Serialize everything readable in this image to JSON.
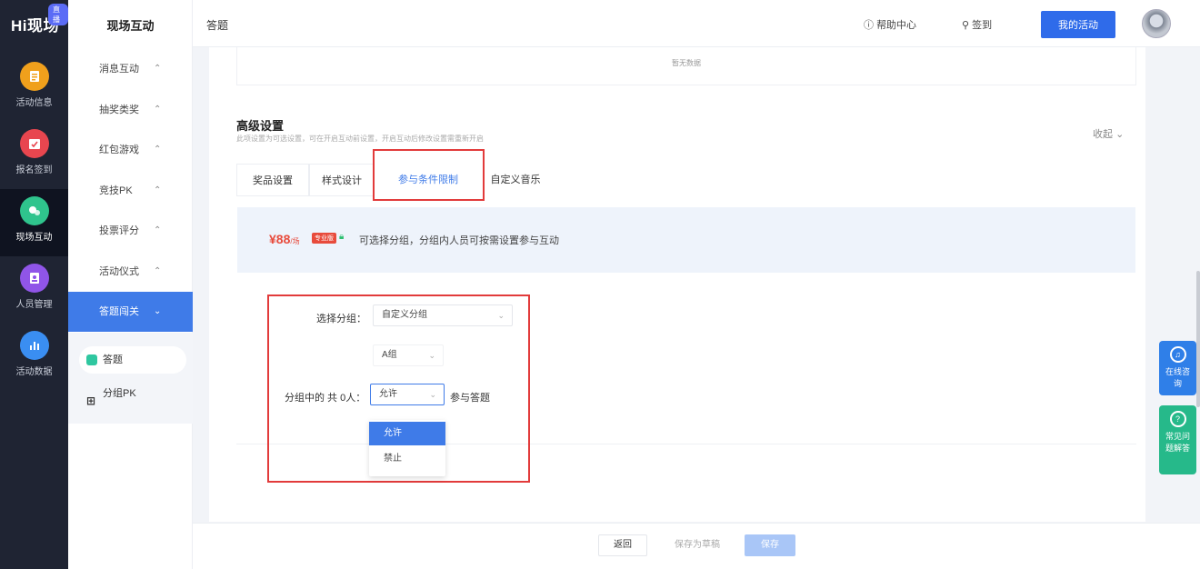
{
  "app": {
    "logo": "Hi现场",
    "badge": "直播"
  },
  "rail": [
    {
      "label": "活动信息",
      "icon": "document-icon",
      "color": "#f0a01c"
    },
    {
      "label": "报名签到",
      "icon": "calendar-check-icon",
      "color": "#e8464f"
    },
    {
      "label": "现场互动",
      "icon": "interaction-icon",
      "color": "#2fc48d"
    },
    {
      "label": "人员管理",
      "icon": "person-icon",
      "color": "#9055e8"
    },
    {
      "label": "活动数据",
      "icon": "bar-chart-icon",
      "color": "#3a8ef2"
    }
  ],
  "sidebar": {
    "title": "现场互动",
    "items": [
      {
        "label": "消息互动"
      },
      {
        "label": "抽奖类奖"
      },
      {
        "label": "红包游戏"
      },
      {
        "label": "竞技PK"
      },
      {
        "label": "投票评分"
      },
      {
        "label": "活动仪式"
      },
      {
        "label": "答题闯关"
      }
    ],
    "children": [
      {
        "label": "答题"
      },
      {
        "label": "分组PK"
      }
    ]
  },
  "topbar": {
    "breadcrumb": "答题",
    "help": "帮助中心",
    "sign": "签到",
    "primary": "我的活动"
  },
  "main": {
    "upper_text": "暂无数据",
    "section_title": "高级设置",
    "section_desc": "此项设置为可选设置，可在开启互动前设置，开启互动后修改设置需重新开启",
    "collapse": "收起",
    "tabs": [
      "奖品设置",
      "样式设计",
      "参与条件限制",
      "自定义音乐"
    ],
    "notice": {
      "price": "¥88",
      "unit": "/场",
      "vip": "专业版",
      "text": "可选择分组，分组内人员可按需设置参与互动"
    },
    "form": {
      "group_label": "选择分组：",
      "group_value": "自定义分组",
      "subgroup_value": "A组",
      "count_label": "分组中的 共 0人：",
      "permission_value": "允许",
      "suffix": "参与答题",
      "options": [
        "允许",
        "禁止"
      ]
    }
  },
  "footer": {
    "back": "返回",
    "draft": "保存为草稿",
    "save": "保存"
  },
  "floats": [
    {
      "label": "在线咨询",
      "color": "#2f7fe8"
    },
    {
      "label": "常见问题解答",
      "color": "#26b98a"
    }
  ]
}
